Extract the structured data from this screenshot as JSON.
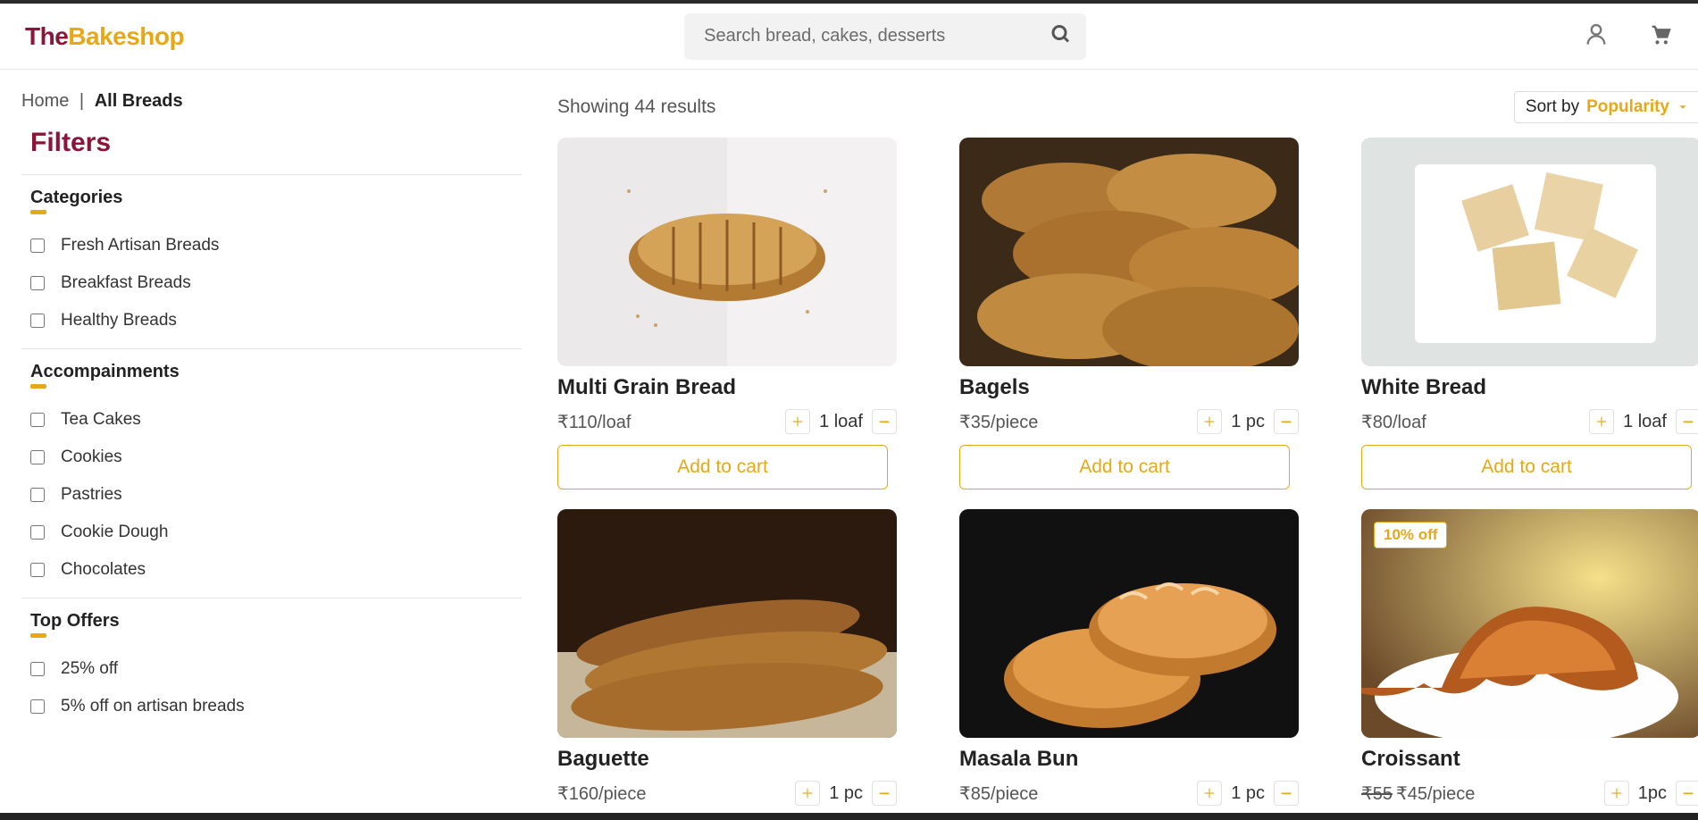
{
  "logo": {
    "part1": "The",
    "part2": "Bakeshop"
  },
  "search": {
    "placeholder": "Search bread, cakes, desserts"
  },
  "breadcrumb": {
    "home": "Home",
    "sep": "|",
    "current": "All Breads"
  },
  "results": {
    "text": "Showing 44 results"
  },
  "sort": {
    "label": "Sort by",
    "value": "Popularity"
  },
  "filters_title": "Filters",
  "filter_sections": {
    "categories": {
      "title": "Categories",
      "items": [
        "Fresh Artisan Breads",
        "Breakfast Breads",
        "Healthy Breads"
      ]
    },
    "accompainments": {
      "title": "Accompainments",
      "items": [
        "Tea Cakes",
        "Cookies",
        "Pastries",
        "Cookie Dough",
        "Chocolates"
      ]
    },
    "offers": {
      "title": "Top Offers",
      "items": [
        "25% off",
        "5% off on artisan breads"
      ]
    }
  },
  "add_to_cart_label": "Add to cart",
  "products": [
    {
      "name": "Multi Grain Bread",
      "price": "₹110/loaf",
      "qty": "1 loaf",
      "discount": "",
      "original": ""
    },
    {
      "name": "Bagels",
      "price": "₹35/piece",
      "qty": "1 pc",
      "discount": "",
      "original": ""
    },
    {
      "name": "White Bread",
      "price": "₹80/loaf",
      "qty": "1 loaf",
      "discount": "",
      "original": ""
    },
    {
      "name": "Baguette",
      "price": "₹160/piece",
      "qty": "1 pc",
      "discount": "",
      "original": ""
    },
    {
      "name": "Masala Bun",
      "price": "₹85/piece",
      "qty": "1 pc",
      "discount": "",
      "original": ""
    },
    {
      "name": "Croissant",
      "price": "₹45/piece",
      "qty": "1pc",
      "discount": "10% off",
      "original": "₹55"
    }
  ]
}
